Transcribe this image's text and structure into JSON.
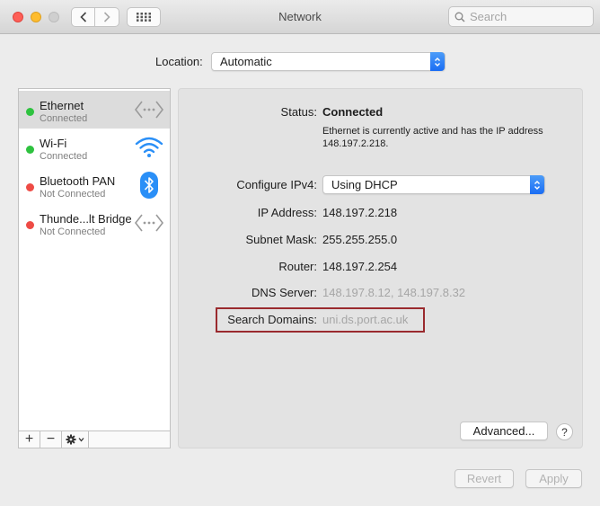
{
  "window": {
    "title": "Network",
    "search_placeholder": "Search"
  },
  "location": {
    "label": "Location:",
    "value": "Automatic"
  },
  "services": [
    {
      "name": "Ethernet",
      "status": "Connected",
      "status_color": "#2ec23f",
      "icon": "ethernet-icon",
      "selected": true
    },
    {
      "name": "Wi-Fi",
      "status": "Connected",
      "status_color": "#2ec23f",
      "icon": "wifi-icon",
      "selected": false
    },
    {
      "name": "Bluetooth PAN",
      "status": "Not Connected",
      "status_color": "#ee4b45",
      "icon": "bluetooth-icon",
      "selected": false
    },
    {
      "name": "Thunde...lt Bridge",
      "status": "Not Connected",
      "status_color": "#ee4b45",
      "icon": "thunderbolt-bridge-icon",
      "selected": false
    }
  ],
  "sidebar_tools": {
    "add": "+",
    "remove": "−"
  },
  "detail": {
    "status_label": "Status:",
    "status_value": "Connected",
    "status_description": "Ethernet is currently active and has the IP address 148.197.2.218.",
    "configure_label": "Configure IPv4:",
    "configure_value": "Using DHCP",
    "ip_label": "IP Address:",
    "ip_value": "148.197.2.218",
    "subnet_label": "Subnet Mask:",
    "subnet_value": "255.255.255.0",
    "router_label": "Router:",
    "router_value": "148.197.2.254",
    "dns_label": "DNS Server:",
    "dns_value": "148.197.8.12, 148.197.8.32",
    "search_domains_label": "Search Domains:",
    "search_domains_value": "uni.ds.port.ac.uk",
    "advanced_button": "Advanced...",
    "help_button": "?"
  },
  "footer": {
    "revert_button": "Revert",
    "apply_button": "Apply"
  },
  "colors": {
    "accent": "#1a6df4",
    "highlight_border": "#9a2a2e",
    "connected": "#2ec23f",
    "not_connected": "#ee4b45"
  }
}
